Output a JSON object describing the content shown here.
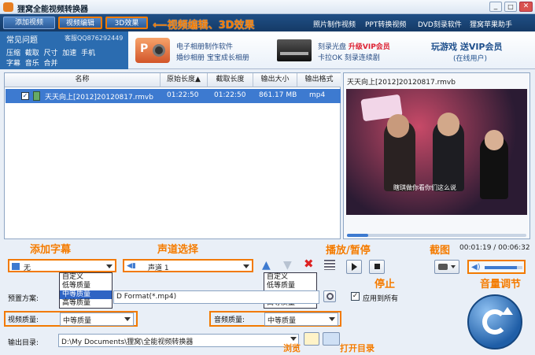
{
  "window": {
    "title": "狸窝全能视频转换器"
  },
  "toolbar": {
    "add_video": "添加视频",
    "video_edit": "视频编辑",
    "effect_3d": "3D效果",
    "right_links": [
      "照片制作视频",
      "PPT转换视频",
      "DVD刻录软件",
      "狸窝苹果助手"
    ]
  },
  "annotations": {
    "edit": "视频编辑、3D效果",
    "subtitle": "添加字幕",
    "audio_track": "声道选择",
    "play_pause": "播放/暂停",
    "stop": "停止",
    "screenshot": "截图",
    "volume": "音量调节",
    "browse": "浏览",
    "open_dir": "打开目录"
  },
  "faq": {
    "title": "常见问题",
    "qq": "客服QQ876292449",
    "row1": [
      "压缩",
      "截取",
      "尺寸",
      "加速",
      "手机"
    ],
    "row2": [
      "字幕",
      "音乐",
      "合并"
    ]
  },
  "promo": {
    "ppt_line1": "电子相册制作软件",
    "ppt_line2": "婚纱相册  宝宝成长相册",
    "dvd_line1": "刻录光盘",
    "dvd_vip": "升级VIP会员",
    "dvd_line2": "卡拉OK  刻录连续剧",
    "game_line1": "玩游戏  送VIP会员",
    "game_line2": "(在线用户)"
  },
  "table": {
    "headers": [
      "名称",
      "原始长度▲",
      "截取长度",
      "输出大小",
      "输出格式"
    ],
    "rows": [
      {
        "name": "天天向上[2012]20120817.rmvb",
        "orig": "01:22:50",
        "cut": "01:22:50",
        "size": "861.17 MB",
        "format": "mp4"
      }
    ]
  },
  "preview": {
    "filename": "天天向上[2012]20120817.rmvb",
    "time": "00:01:19 / 00:06:32",
    "seek_fraction": 0.12,
    "volume_fraction": 0.85,
    "subtitle_text": "瞎琪做你看你们这么说"
  },
  "controls": {
    "subtitle_value": "无",
    "audio_value": "声道 1"
  },
  "dropdown_options": [
    "自定义",
    "低等质量",
    "中等质量",
    "高等质量"
  ],
  "settings": {
    "preset_label": "预置方案:",
    "preset_value": "D Format(*.mp4)",
    "apply_all": "应用到所有",
    "video_quality_label": "视频质量:",
    "video_quality": "中等质量",
    "audio_quality_label": "音频质量:",
    "audio_quality": "中等质量",
    "output_label": "输出目录:",
    "output_path": "D:\\My Documents\\狸窝\\全能视频转换器"
  },
  "colors": {
    "accent": "#f27a00",
    "toolbar": "#1f4f86",
    "selection": "#3d7ad0"
  }
}
